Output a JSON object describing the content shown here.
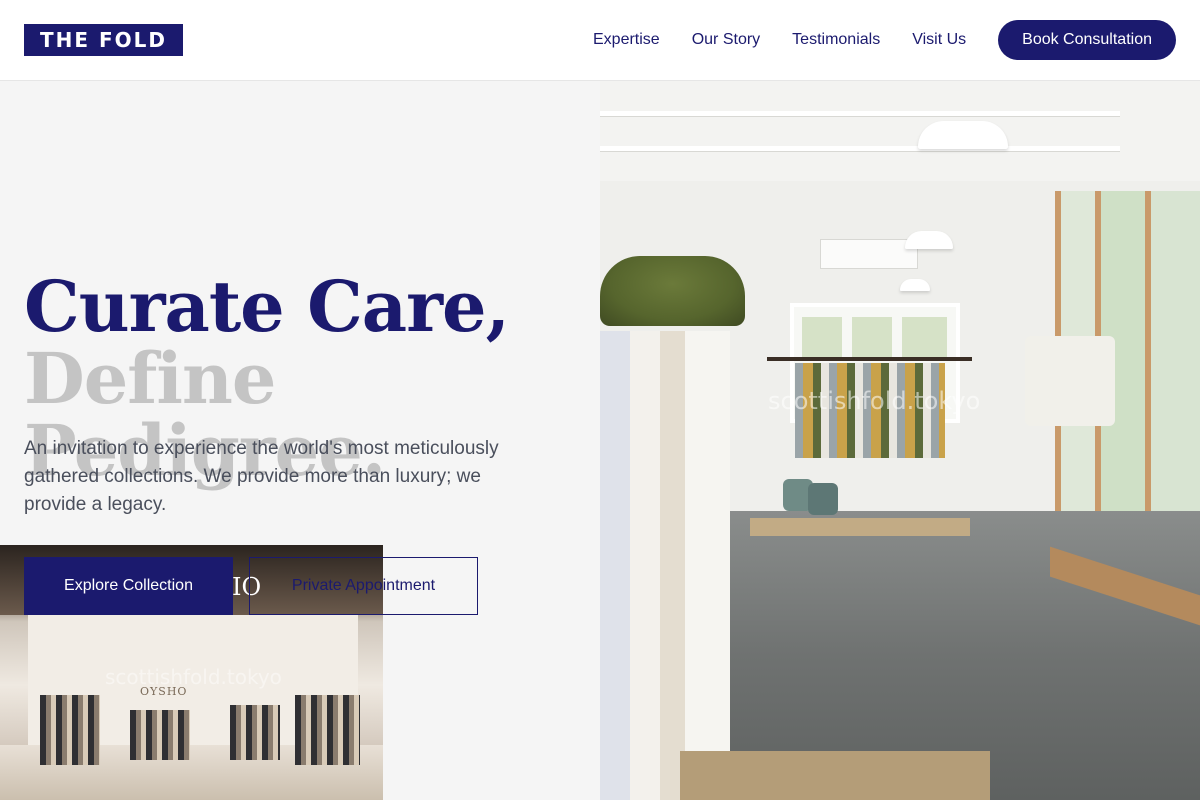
{
  "brand": {
    "logo_text": "THE FOLD",
    "primary_color": "#1b1a6e",
    "muted_heading_color": "#c4c4c4"
  },
  "nav": {
    "items": [
      {
        "label": "Expertise"
      },
      {
        "label": "Our Story"
      },
      {
        "label": "Testimonials"
      },
      {
        "label": "Visit Us"
      }
    ],
    "cta_label": "Book Consultation"
  },
  "hero": {
    "headline_line1": "Curate Care,",
    "headline_line2": "Define Pedigree.",
    "lead": "An invitation to experience the world's most meticulously gathered collections. We provide more than luxury; we provide a legacy.",
    "primary_button": "Explore Collection",
    "secondary_button": "Private Appointment"
  },
  "images": {
    "small_photo_watermark": "scottishfold.tokyo",
    "small_photo_store_sign": "OYSHO",
    "small_photo_logo_letters": "IO",
    "big_photo_watermark": "scottishfold.tokyo"
  },
  "icons": {}
}
